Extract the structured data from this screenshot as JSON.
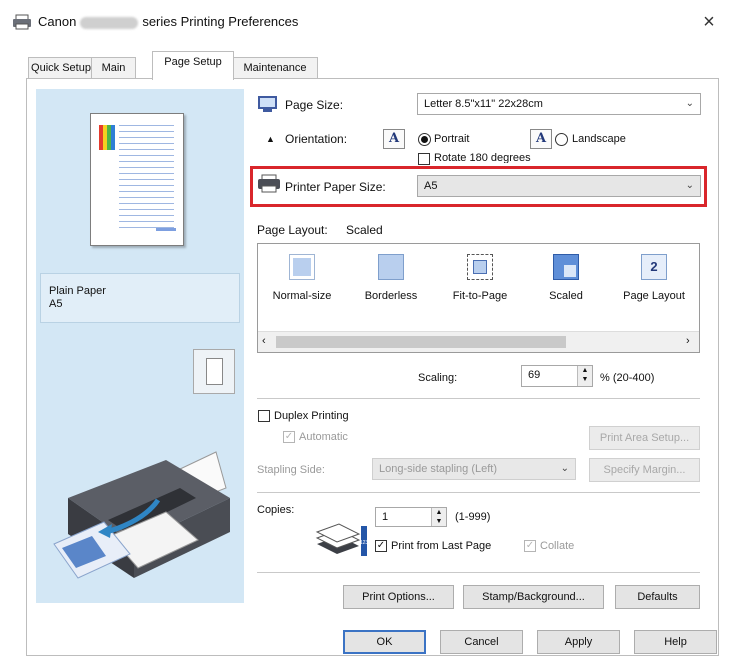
{
  "window": {
    "title_prefix": "Canon",
    "title_suffix": "series Printing Preferences",
    "close_glyph": "×"
  },
  "tabs": [
    {
      "label": "Quick Setup",
      "active": false
    },
    {
      "label": "Main",
      "active": false
    },
    {
      "label": "Page Setup",
      "active": true
    },
    {
      "label": "Maintenance",
      "active": false
    }
  ],
  "preview": {
    "paper_type": "Plain Paper",
    "paper_size": "A5"
  },
  "page_setup": {
    "page_size_label": "Page Size:",
    "page_size_value": "Letter 8.5\"x11\" 22x28cm",
    "orientation_label": "Orientation:",
    "portrait_label": "Portrait",
    "landscape_label": "Landscape",
    "orientation_selected": "Portrait",
    "rotate_label": "Rotate 180 degrees",
    "printer_paper_size_label": "Printer Paper Size:",
    "printer_paper_size_value": "A5",
    "highlight_color": "#d9262b",
    "page_layout_label": "Page Layout:",
    "page_layout_value": "Scaled",
    "layout_options": [
      {
        "label": "Normal-size",
        "icon": "normal-size-icon"
      },
      {
        "label": "Borderless",
        "icon": "borderless-icon"
      },
      {
        "label": "Fit-to-Page",
        "icon": "fit-to-page-icon"
      },
      {
        "label": "Scaled",
        "icon": "scaled-icon"
      },
      {
        "label": "Page Layout",
        "icon": "page-layout-icon"
      }
    ],
    "page_layout_number": "2",
    "scaling_label": "Scaling:",
    "scaling_value": "69",
    "scaling_range": "% (20-400)"
  },
  "duplex": {
    "duplex_label": "Duplex Printing",
    "automatic_label": "Automatic",
    "print_area_button": "Print Area Setup...",
    "stapling_label": "Stapling Side:",
    "stapling_value": "Long-side stapling (Left)",
    "specify_margin_button": "Specify Margin..."
  },
  "copies": {
    "copies_label": "Copies:",
    "copies_value": "1",
    "copies_range": "(1-999)",
    "print_from_last_label": "Print from Last Page",
    "collate_label": "Collate"
  },
  "bottom_buttons": {
    "print_options": "Print Options...",
    "stamp_background": "Stamp/Background...",
    "defaults": "Defaults"
  },
  "dialog_buttons": {
    "ok": "OK",
    "cancel": "Cancel",
    "apply": "Apply",
    "help": "Help"
  }
}
